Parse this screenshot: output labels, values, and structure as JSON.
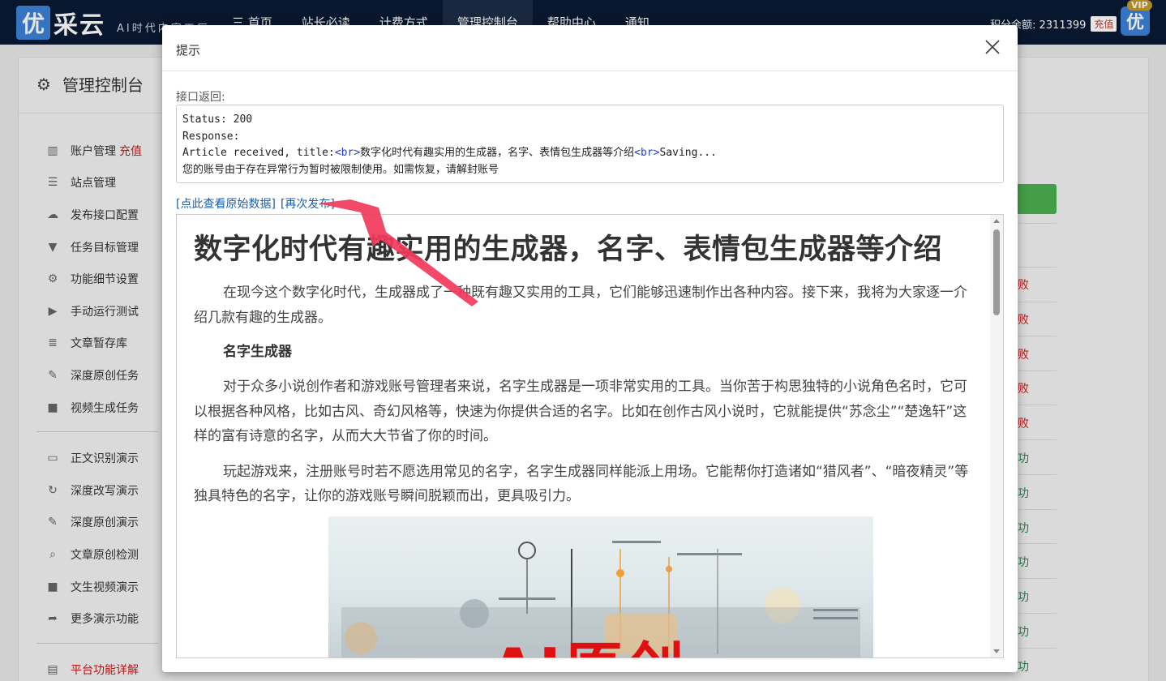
{
  "nav": {
    "logo_mark": "优",
    "logo_text": "采云",
    "slogan": "AI时代内容工厂",
    "items": [
      {
        "label": "三 首页"
      },
      {
        "label": "站长必读"
      },
      {
        "label": "计费方式"
      },
      {
        "label": "管理控制台"
      },
      {
        "label": "帮助中心"
      },
      {
        "label": "通知"
      }
    ],
    "credits_label": "积分余额: 2311399",
    "recharge_label": "充值",
    "avatar_char": "优",
    "vip_label": "VIP"
  },
  "panel": {
    "title": "管理控制台",
    "menu": [
      {
        "label": "账户管理",
        "extra": "充值",
        "icon": "bar-chart-icon"
      },
      {
        "label": "站点管理",
        "icon": "server-icon"
      },
      {
        "label": "发布接口配置",
        "icon": "cloud-upload-icon"
      },
      {
        "label": "任务目标管理",
        "icon": "filter-icon"
      },
      {
        "label": "功能细节设置",
        "icon": "cogs-icon"
      },
      {
        "label": "手动运行测试",
        "icon": "play-icon"
      },
      {
        "label": "文章暂存库",
        "icon": "database-icon"
      },
      {
        "label": "深度原创任务",
        "icon": "edit-icon"
      },
      {
        "label": "视频生成任务",
        "icon": "video-icon"
      }
    ],
    "menu2": [
      {
        "label": "正文识别演示",
        "icon": "monitor-icon"
      },
      {
        "label": "深度改写演示",
        "icon": "refresh-icon"
      },
      {
        "label": "深度原创演示",
        "icon": "edit-icon"
      },
      {
        "label": "文章原创检测",
        "icon": "search-icon"
      },
      {
        "label": "文生视频演示",
        "icon": "video-icon"
      },
      {
        "label": "更多演示功能",
        "icon": "share-icon"
      }
    ],
    "menu3": [
      {
        "label": "平台功能详解",
        "icon": "document-icon"
      }
    ],
    "statuses": [
      "败",
      "败",
      "败",
      "败",
      "败",
      "功",
      "功",
      "功",
      "功",
      "功",
      "功",
      "功"
    ]
  },
  "modal": {
    "title": "提示",
    "response_label": "接口返回:",
    "response_lines": {
      "status": "Status: 200",
      "response": "Response:",
      "article_prefix": "Article received, title:",
      "tag_br": "<br>",
      "article_title": "数字化时代有趣实用的生成器，名字、表情包生成器等介绍",
      "saving": "Saving...",
      "account_msg": "您的账号由于存在异常行为暂时被限制使用。如需恢复，请解封账号"
    },
    "link_raw": "[点此查看原始数据]",
    "link_republish": "[再次发布]",
    "article": {
      "title": "数字化时代有趣实用的生成器，名字、表情包生成器等介绍",
      "p1": "在现今这个数字化时代，生成器成了一种既有趣又实用的工具，它们能够迅速制作出各种内容。接下来，我将为大家逐一介绍几款有趣的生成器。",
      "h1": "名字生成器",
      "p2": "对于众多小说创作者和游戏账号管理者来说，名字生成器是一项非常实用的工具。当你苦于构思独特的小说角色名时，它可以根据各种风格，比如古风、奇幻风格等，快速为你提供合适的名字。比如在创作古风小说时，它就能提供“苏念尘”“楚逸轩”这样的富有诗意的名字，从而大大节省了你的时间。",
      "p3": "玩起游戏来，注册账号时若不愿选用常见的名字，名字生成器同样能派上用场。它能帮你打造诸如“猎风者”、“暗夜精灵”等独具特色的名字，让你的游戏账号瞬间脱颖而出，更具吸引力。",
      "image_text": "AI原创"
    }
  }
}
